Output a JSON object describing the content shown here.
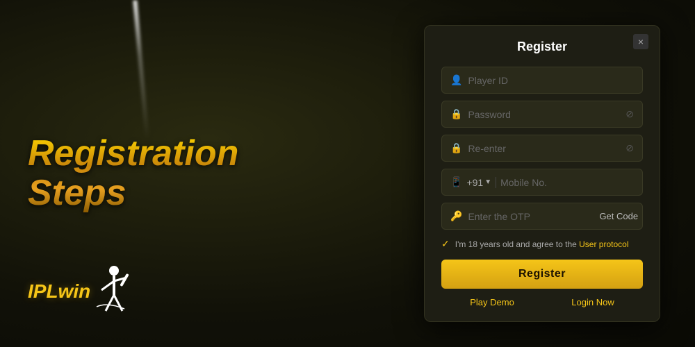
{
  "page": {
    "background": "#1a1a0e"
  },
  "left": {
    "title_line1": "Registration",
    "title_line2": "Steps"
  },
  "logo": {
    "text": "IPLwin"
  },
  "modal": {
    "title": "Register",
    "close_label": "×",
    "fields": {
      "player_id_placeholder": "Player ID",
      "password_placeholder": "Password",
      "reenter_placeholder": "Re-enter",
      "country_code": "+91",
      "mobile_placeholder": "Mobile No.",
      "otp_placeholder": "Enter the OTP",
      "get_code_label": "Get Code"
    },
    "agreement": {
      "text": "I'm 18 years old and agree to the ",
      "link_text": "User protocol"
    },
    "register_label": "Register",
    "play_demo_label": "Play Demo",
    "login_now_label": "Login Now"
  }
}
